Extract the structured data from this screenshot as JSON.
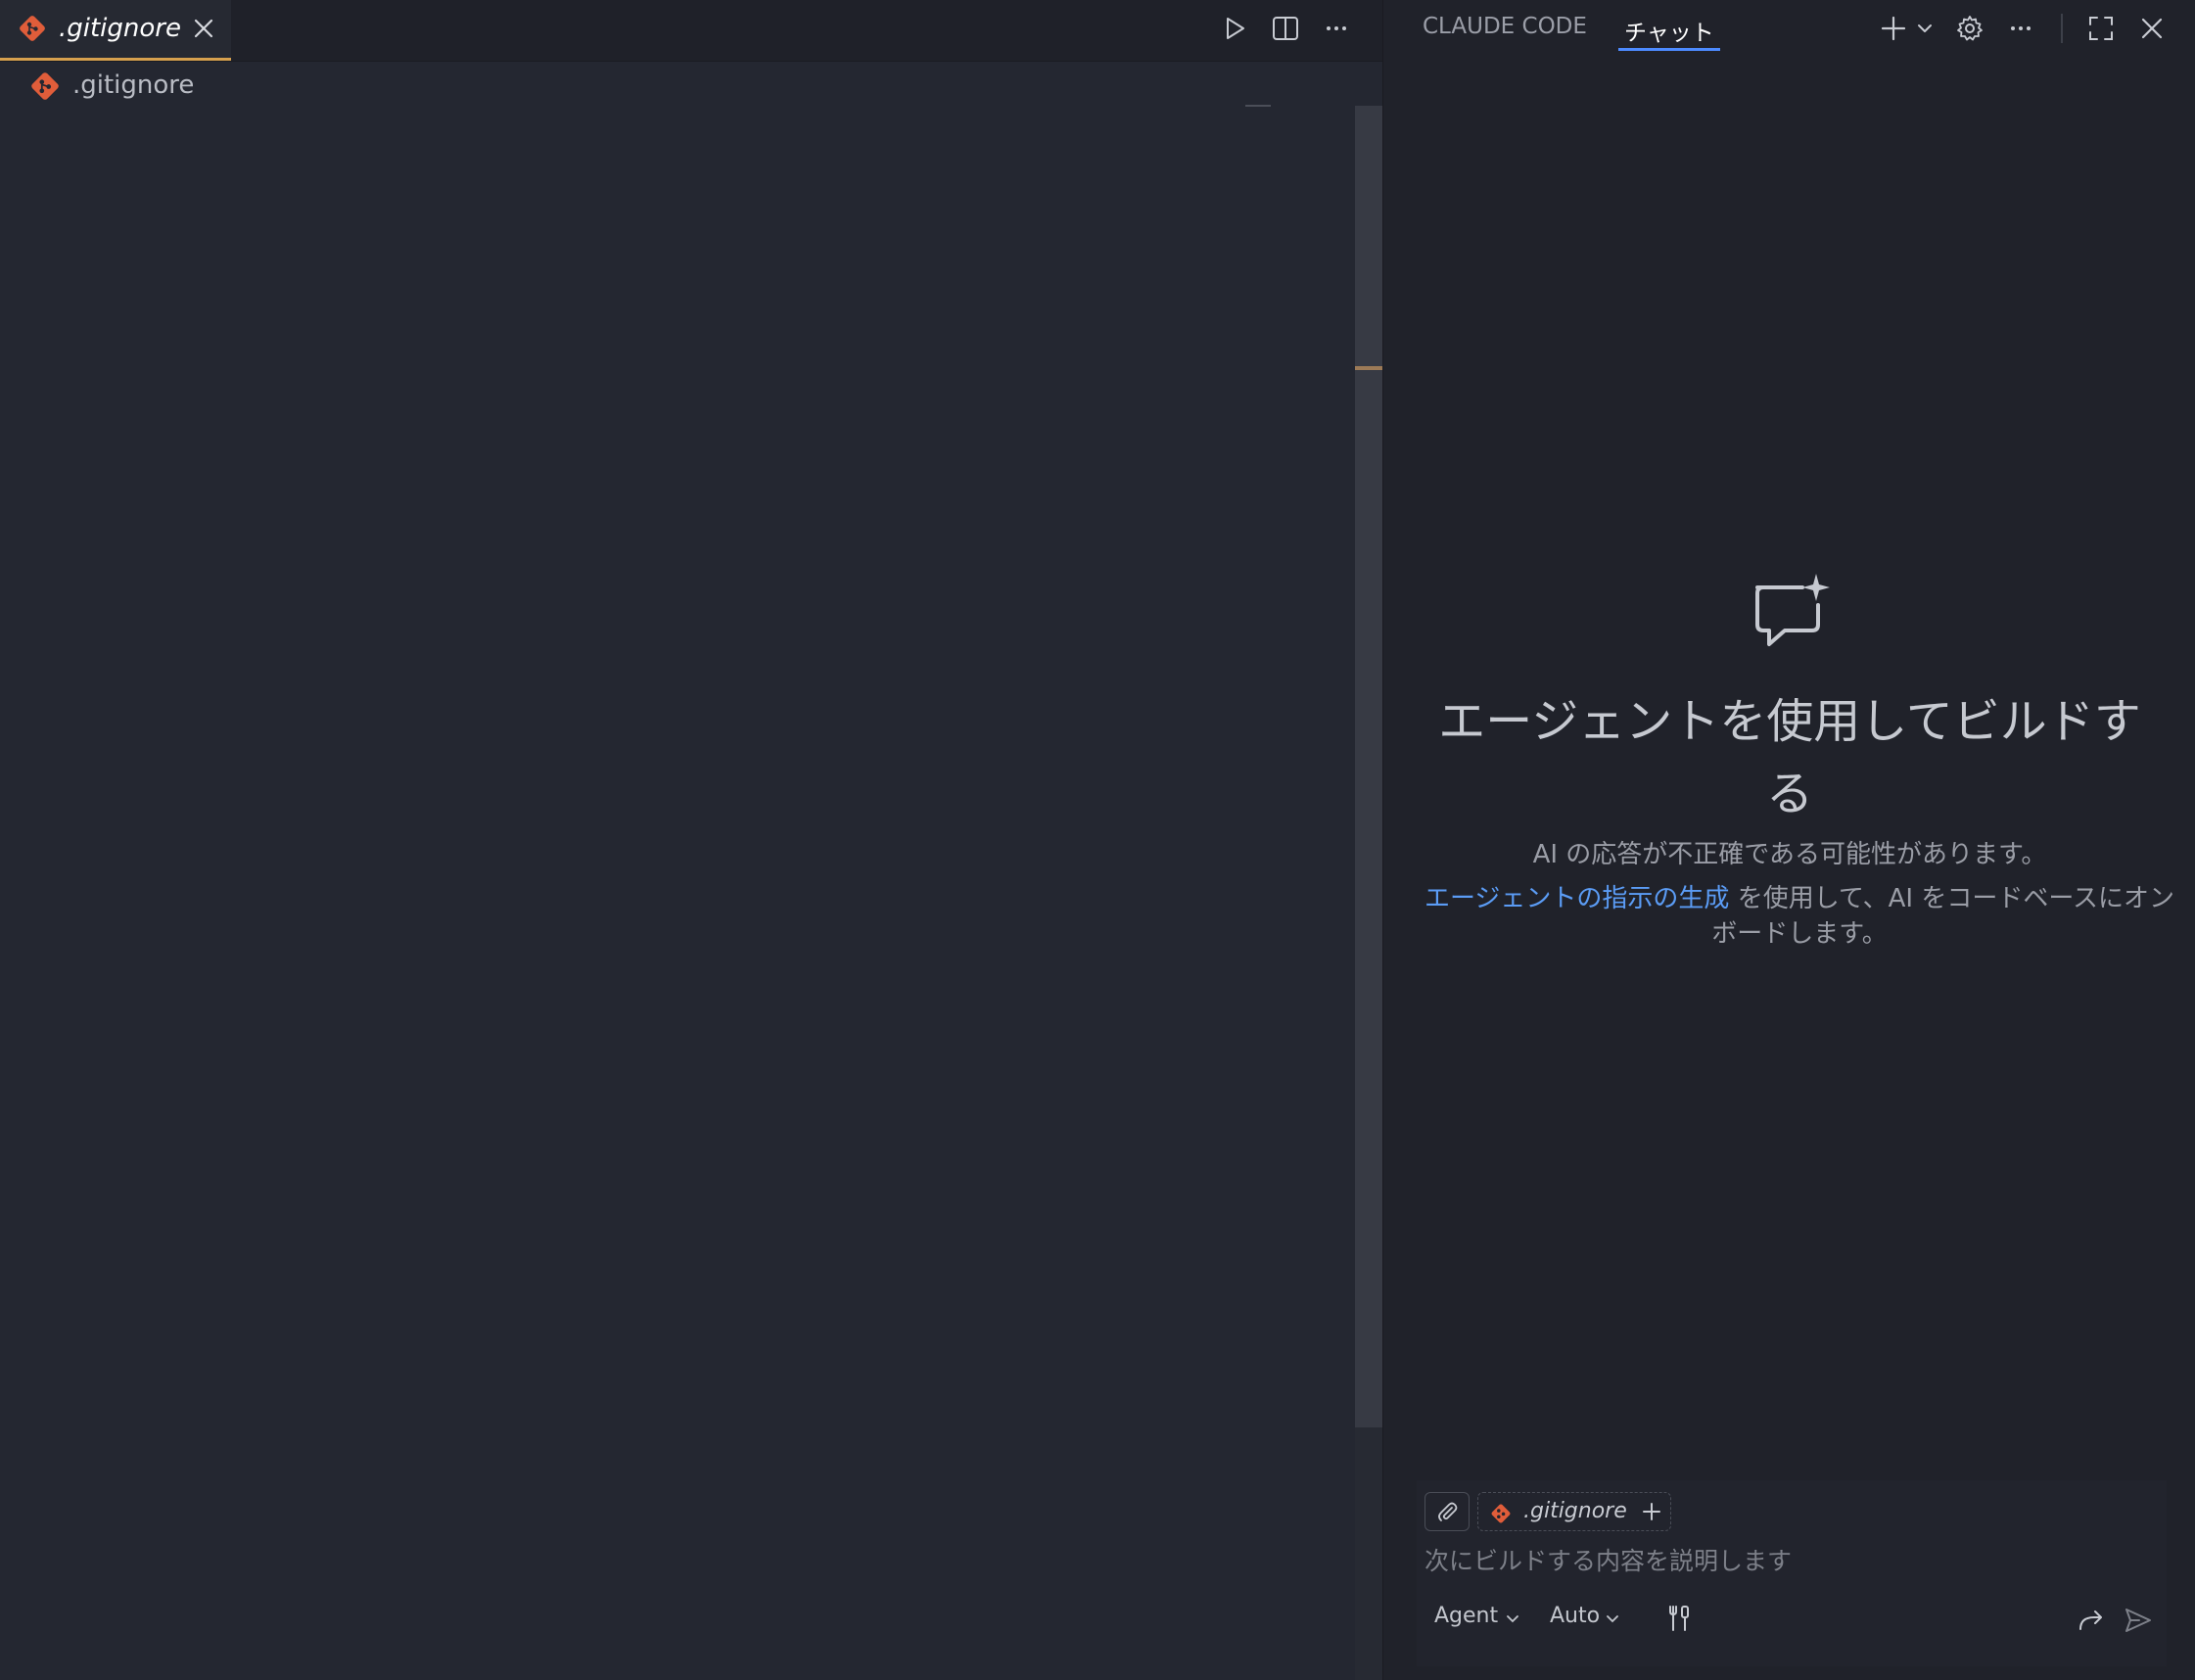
{
  "editor": {
    "tab": {
      "filename": ".gitignore"
    },
    "breadcrumb": {
      "filename": ".gitignore"
    }
  },
  "chat": {
    "tabs": {
      "claude_code": "CLAUDE CODE",
      "chat": "チャット"
    },
    "empty_state": {
      "title": "エージェントを使用してビルドする",
      "subtitle": "AI の応答が不正確である可能性があります。",
      "hint_link": "エージェントの指示の生成",
      "hint_text": " を使用して、AI をコードベースにオンボードします。"
    },
    "composer": {
      "context_file": ".gitignore",
      "placeholder": "次にビルドする内容を説明します",
      "mode": "Agent",
      "model": "Auto"
    }
  },
  "colors": {
    "accent": "#4d8bff",
    "git_icon": "#e05d3a",
    "tab_underline": "#d6a04e",
    "link": "#5b9cf5"
  }
}
